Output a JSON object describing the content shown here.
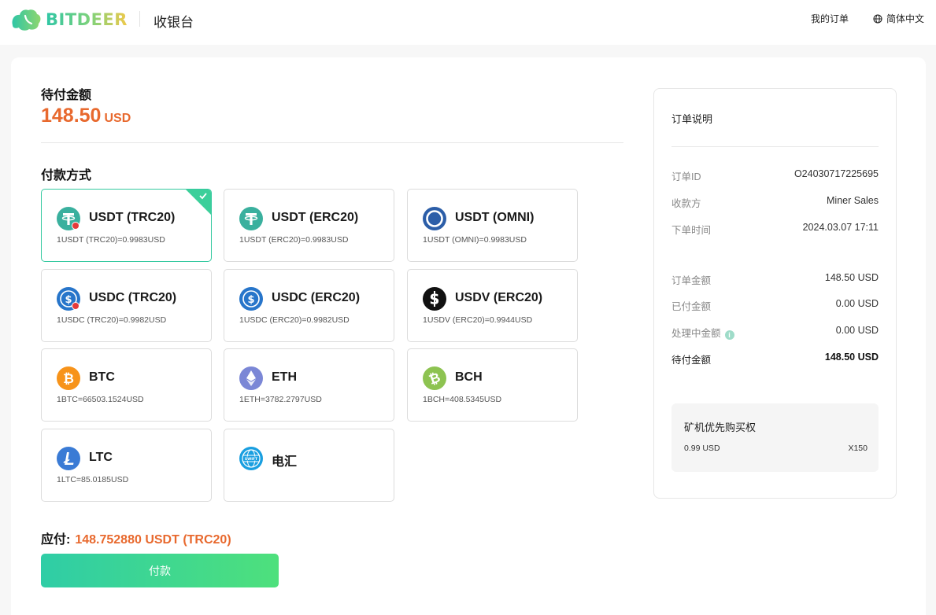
{
  "header": {
    "logo_text": "BITDEER",
    "app_title": "收银台",
    "my_orders": "我的订单",
    "language": "简体中文"
  },
  "payment": {
    "due_label": "待付金额",
    "due_amount": "148.50",
    "due_currency": "USD",
    "method_label": "付款方式",
    "methods": [
      {
        "name": "USDT (TRC20)",
        "rate": "1USDT (TRC20)=0.9983USD",
        "icon": "tether-icon",
        "selected": true
      },
      {
        "name": "USDT (ERC20)",
        "rate": "1USDT (ERC20)=0.9983USD",
        "icon": "tether-icon"
      },
      {
        "name": "USDT (OMNI)",
        "rate": "1USDT (OMNI)=0.9983USD",
        "icon": "omni-icon"
      },
      {
        "name": "USDC (TRC20)",
        "rate": "1USDC (TRC20)=0.9982USD",
        "icon": "usdc-icon"
      },
      {
        "name": "USDC (ERC20)",
        "rate": "1USDC (ERC20)=0.9982USD",
        "icon": "usdc-icon"
      },
      {
        "name": "USDV (ERC20)",
        "rate": "1USDV (ERC20)=0.9944USD",
        "icon": "usdv-icon"
      },
      {
        "name": "BTC",
        "rate": "1BTC=66503.1524USD",
        "icon": "bitcoin-icon"
      },
      {
        "name": "ETH",
        "rate": "1ETH=3782.2797USD",
        "icon": "ethereum-icon"
      },
      {
        "name": "BCH",
        "rate": "1BCH=408.5345USD",
        "icon": "bitcoin-cash-icon"
      },
      {
        "name": "LTC",
        "rate": "1LTC=85.0185USD",
        "icon": "litecoin-icon"
      },
      {
        "name": "电汇",
        "rate": "",
        "icon": "swift-icon"
      }
    ],
    "pay_label": "应付:",
    "pay_value": "148.752880 USDT (TRC20)",
    "pay_button": "付款"
  },
  "order": {
    "title": "订单说明",
    "order_id_label": "订单ID",
    "order_id": "O24030717225695",
    "payee_label": "收款方",
    "payee": "Miner Sales",
    "time_label": "下单时间",
    "time": "2024.03.07 17:11",
    "order_amount_label": "订单金额",
    "order_amount": "148.50 USD",
    "paid_label": "已付金额",
    "paid": "0.00 USD",
    "processing_label": "处理中金额",
    "processing": "0.00 USD",
    "due_label": "待付金额",
    "due": "148.50 USD",
    "item": {
      "title": "矿机优先购买权",
      "price": "0.99 USD",
      "qty": "X150"
    }
  },
  "colors": {
    "accent_orange": "#e8692e",
    "accent_green": "#35c9a0"
  }
}
